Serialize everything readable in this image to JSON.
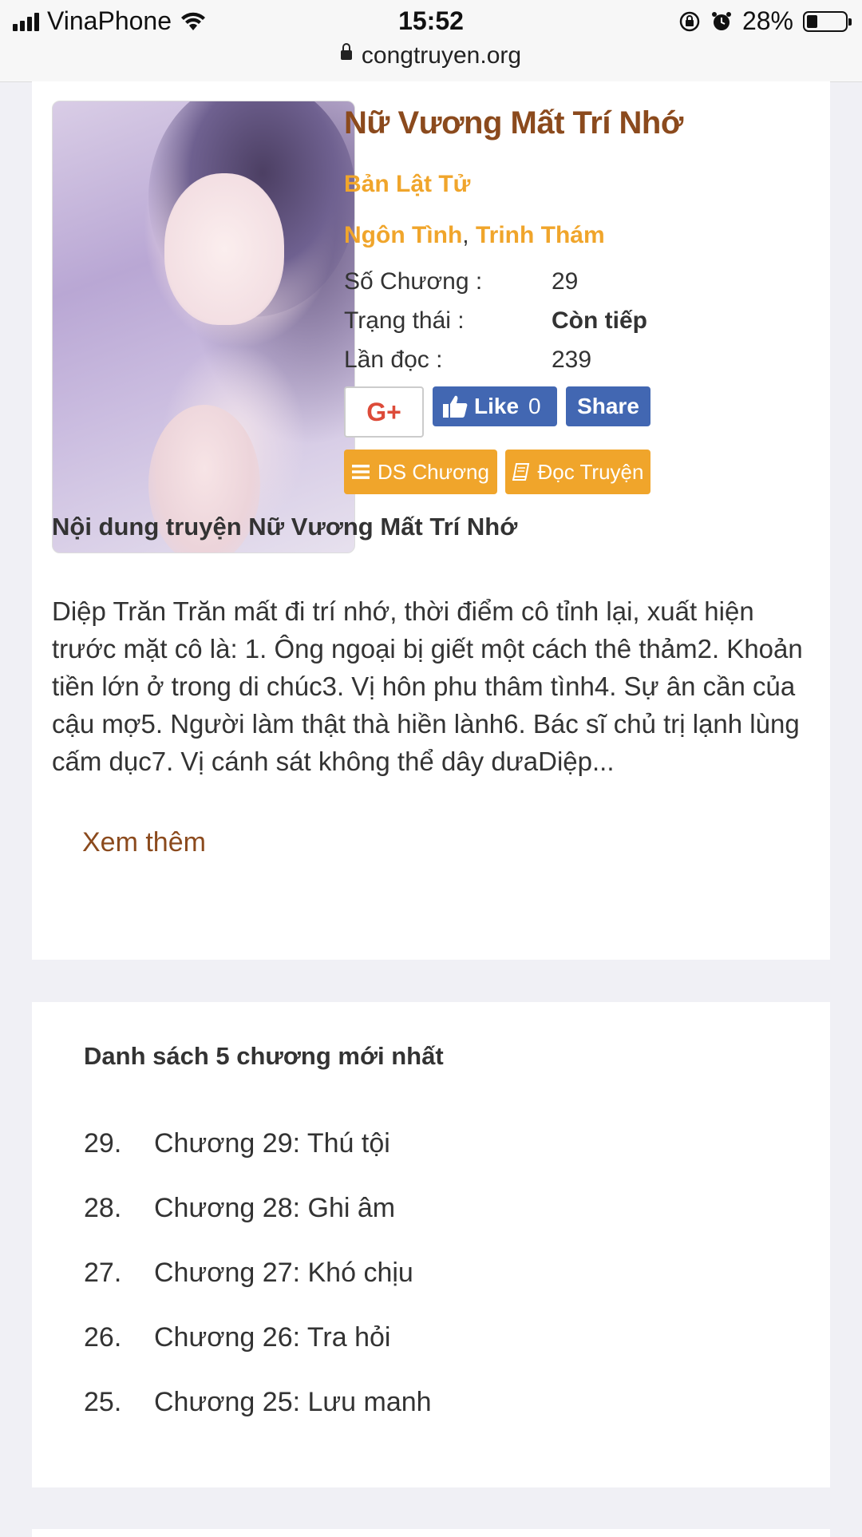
{
  "status_bar": {
    "carrier": "VinaPhone",
    "time": "15:52",
    "battery": "28%",
    "battery_level": 0.28
  },
  "browser": {
    "url": "congtruyen.org"
  },
  "story": {
    "title": "Nữ Vương Mất Trí Nhớ",
    "author": "Bản Lật Tử",
    "genres": [
      "Ngôn Tình",
      "Trinh Thám"
    ],
    "genre_separator": ",",
    "info": [
      {
        "label": "Số Chương :",
        "value": "29"
      },
      {
        "label": "Trạng thái :",
        "value": "Còn tiếp"
      },
      {
        "label": "Lần đọc :",
        "value": "239"
      }
    ]
  },
  "social": {
    "gplus_label": "G+",
    "like_label": "Like",
    "like_count": "0",
    "share_label": "Share"
  },
  "actions": {
    "chapter_list_label": "DS Chương",
    "read_label": "Đọc Truyện"
  },
  "content": {
    "heading": "Nội dung truyện Nữ Vương Mất Trí Nhớ",
    "description": "Diệp Trăn Trăn mất đi trí nhớ, thời điểm cô tỉnh lại, xuất hiện trước mặt cô là: 1. Ông ngoại bị giết một cách thê thảm2. Khoản tiền lớn ở trong di chúc3. Vị hôn phu thâm tình4. Sự ân cần của cậu mợ5. Người làm thật thà hiền lành6. Bác sĩ chủ trị lạnh lùng cấm dục7. Vị cánh sát không thể dây dưaDiệp...",
    "more_label": "Xem thêm"
  },
  "latest_chapters": {
    "heading": "Danh sách 5 chương mới nhất",
    "items": [
      {
        "num": "29.",
        "title": "Chương 29: Thú tội"
      },
      {
        "num": "28.",
        "title": "Chương 28: Ghi âm"
      },
      {
        "num": "27.",
        "title": "Chương 27: Khó chịu"
      },
      {
        "num": "26.",
        "title": "Chương 26: Tra hỏi"
      },
      {
        "num": "25.",
        "title": "Chương 25: Lưu manh"
      }
    ]
  },
  "colors": {
    "title_brown": "#8b4a1d",
    "accent_orange": "#f0a52b",
    "facebook_blue": "#4267b2",
    "gplus_red": "#dd4b39"
  }
}
